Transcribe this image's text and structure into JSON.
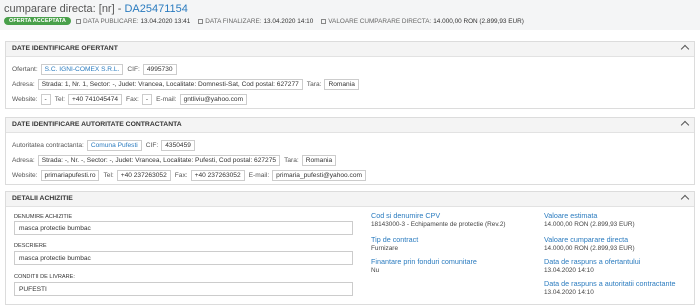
{
  "header": {
    "title_prefix": "cumparare directa: [nr] - ",
    "title_number": "DA25471154",
    "status_badge": "OFERTA ACCEPTATA",
    "publish_label": "DATA PUBLICARE:",
    "publish_value": "13.04.2020 13:41",
    "final_label": "DATA FINALIZARE:",
    "final_value": "13.04.2020 14:10",
    "value_label": "VALOARE CUMPARARE DIRECTA:",
    "value_value": "14.000,00  RON (2.899,93  EUR)"
  },
  "ofertant": {
    "heading": "DATE IDENTIFICARE OFERTANT",
    "ofertant_label": "Ofertant:",
    "ofertant_value": "S.C. IGNI-COMEX S.R.L.",
    "cif_label": "CIF:",
    "cif_value": "4995730",
    "adresa_label": "Adresa:",
    "adresa_value": "Strada: 1, Nr. 1, Sector: -, Judet: Vrancea, Localitate: Domnesti-Sat, Cod postal: 627277",
    "tara_label": "Tara:",
    "tara_value": "Romania",
    "website_label": "Website:",
    "website_value": "-",
    "tel_label": "Tel:",
    "tel_value": "+40 741045474",
    "fax_label": "Fax:",
    "fax_value": "-",
    "email_label": "E-mail:",
    "email_value": "gntliviu@yahoo.com"
  },
  "autoritate": {
    "heading": "DATE IDENTIFICARE AUTORITATE CONTRACTANTA",
    "autoritate_label": "Autoritatea contractanta:",
    "autoritate_value": "Comuna Pufesti",
    "cif_label": "CIF:",
    "cif_value": "4350459",
    "adresa_label": "Adresa:",
    "adresa_value": "Strada: -, Nr. -, Sector: -, Judet: Vrancea, Localitate: Pufesti, Cod postal: 627275",
    "tara_label": "Tara:",
    "tara_value": "Romania",
    "website_label": "Website:",
    "website_value": "primariapufesti.ro",
    "tel_label": "Tel:",
    "tel_value": "+40 237263052",
    "fax_label": "Fax:",
    "fax_value": "+40 237263052",
    "email_label": "E-mail:",
    "email_value": "primaria_pufesti@yahoo.com"
  },
  "detalii": {
    "heading": "DETALII ACHIZITIE",
    "denumire_label": "DENUMIRE ACHIZITIE",
    "denumire_value": "masca protectie bumbac",
    "descriere_label": "DESCRIERE",
    "descriere_value": "masca protectie bumbac",
    "conditii_label": "CONDITII DE LIVRARE:",
    "conditii_value": "PUFESTI",
    "cpv_title": "Cod si denumire CPV",
    "cpv_value": "18143000-3 - Echipamente de protectie (Rev.2)",
    "tip_title": "Tip de contract",
    "tip_value": "Furnizare",
    "fin_title": "Finantare prin fonduri comunitare",
    "fin_value": "Nu",
    "est_title": "Valoare estimata",
    "est_value": "14.000,00  RON (2.899,93  EUR)",
    "cump_title": "Valoare cumparare directa",
    "cump_value": "14.000,00  RON (2.899,93  EUR)",
    "rasp_of_title": "Data de raspuns a ofertantului",
    "rasp_of_value": "13.04.2020 14:10",
    "rasp_aut_title": "Data de raspuns a autoritatii contractante",
    "rasp_aut_value": "13.04.2020 14:10"
  }
}
